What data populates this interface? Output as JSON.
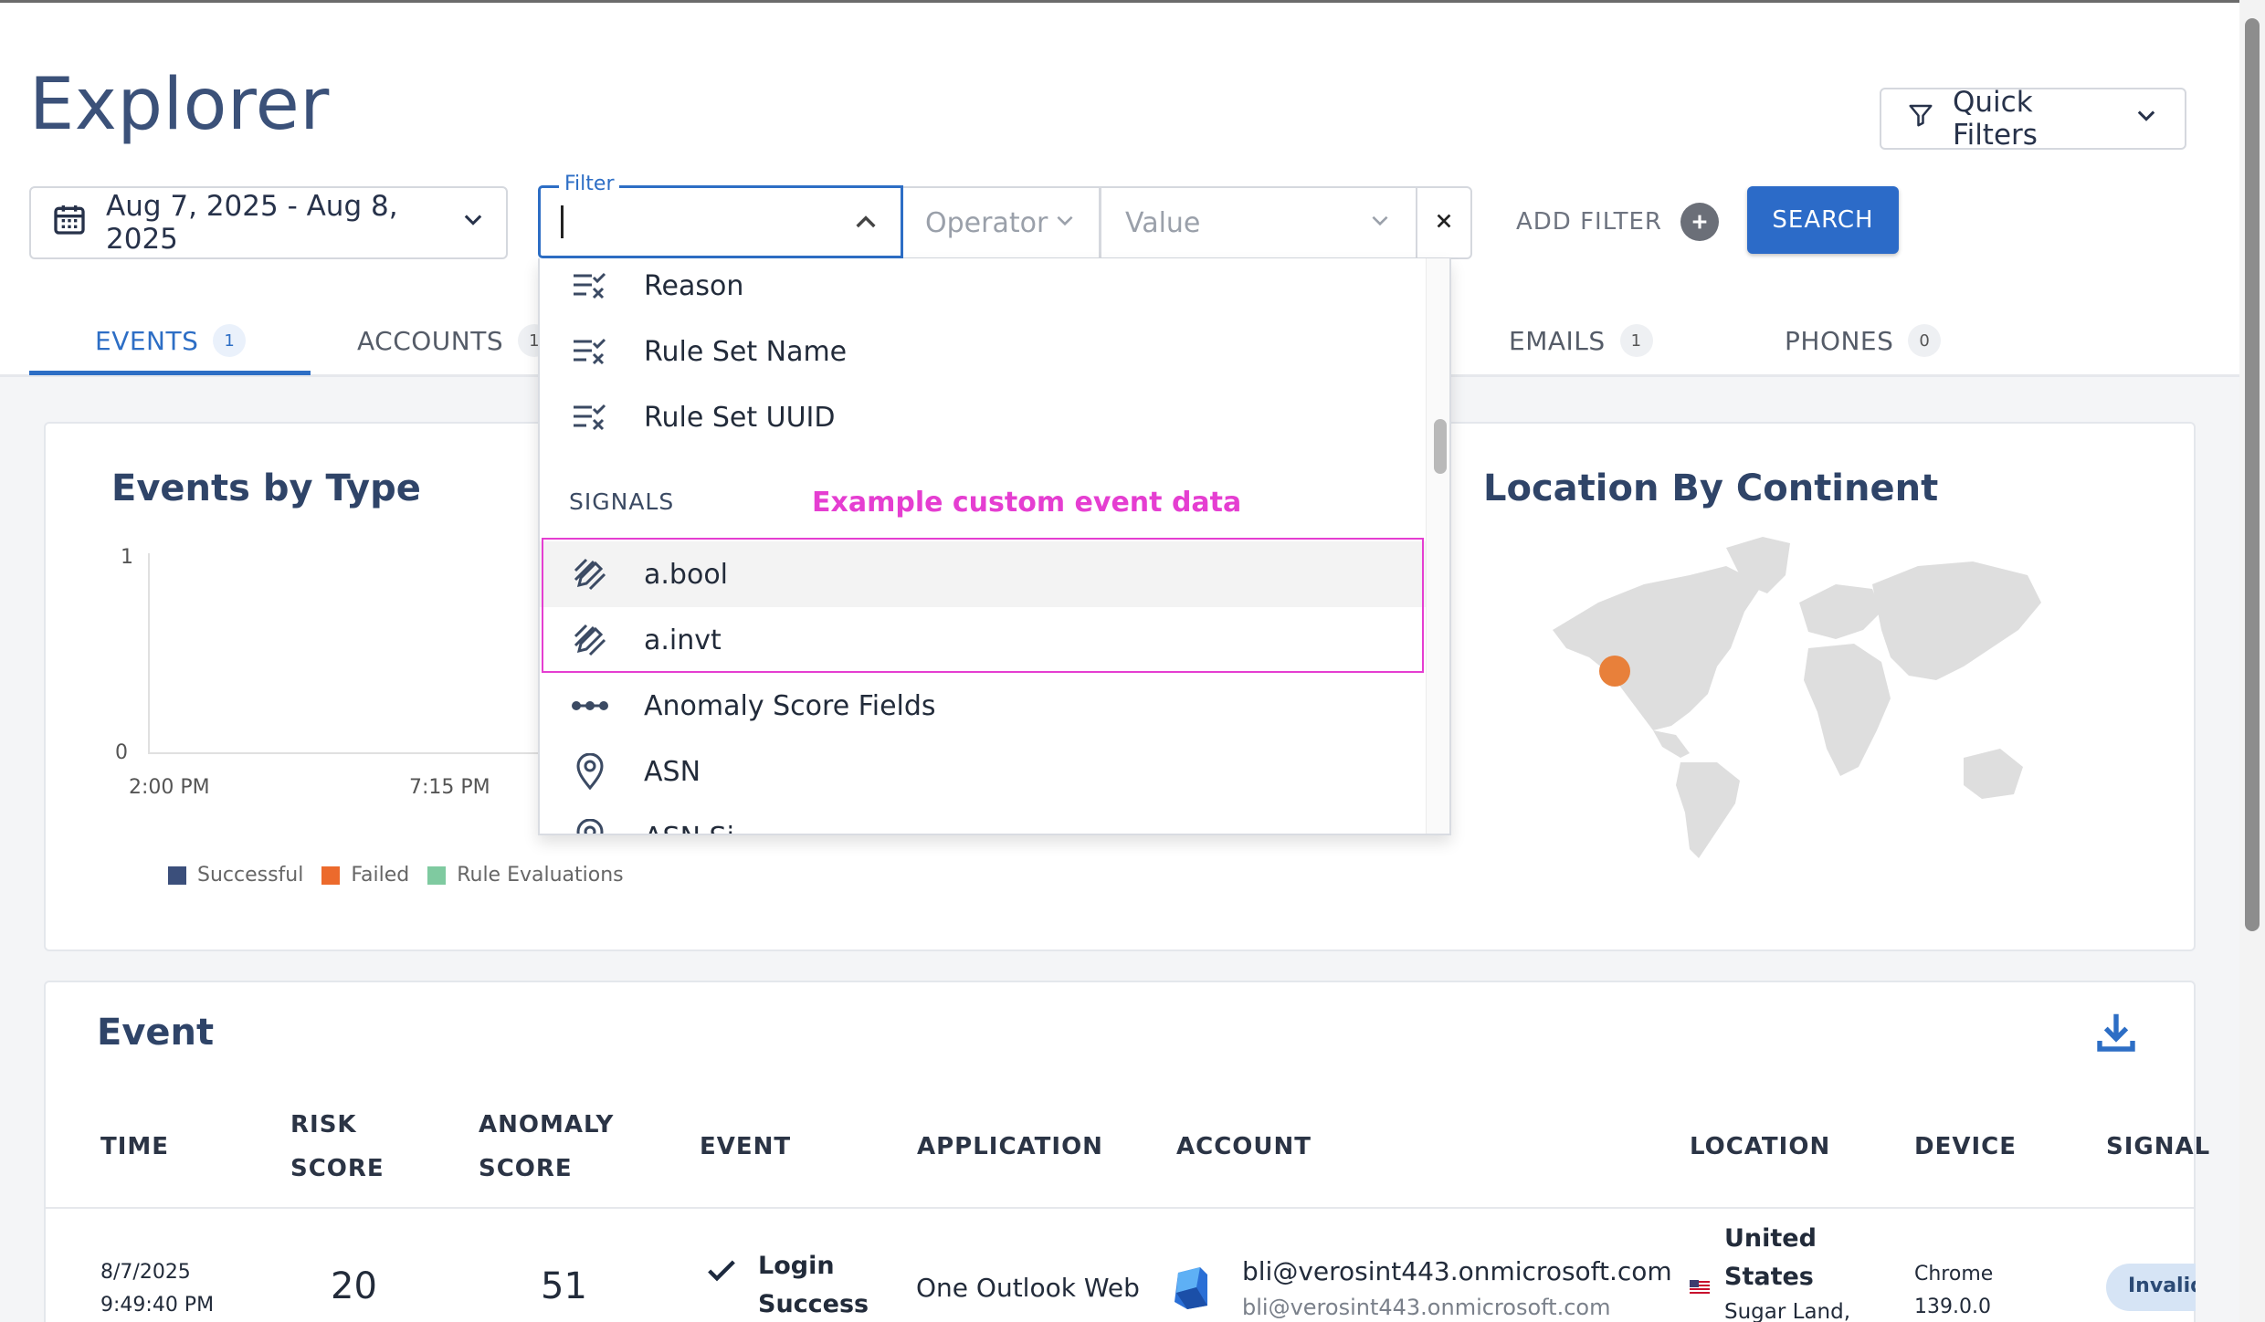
{
  "title": "Explorer",
  "quick_filters": {
    "label": "Quick Filters",
    "icons": [
      "funnel-icon",
      "chevron-down-icon"
    ]
  },
  "date_range": {
    "label": "Aug 7, 2025 - Aug 8, 2025",
    "icon": "calendar-icon"
  },
  "filter": {
    "legend": "Filter",
    "value": "",
    "operator_placeholder": "Operator",
    "value_placeholder": "Value",
    "add_filter": "ADD FILTER",
    "search": "SEARCH"
  },
  "tabs": [
    {
      "label": "EVENTS",
      "count": "1",
      "active": true
    },
    {
      "label": "ACCOUNTS",
      "count": "1"
    },
    {
      "label": "EMAILS",
      "count": "1"
    },
    {
      "label": "PHONES",
      "count": "0"
    }
  ],
  "dropdown": {
    "items_top": [
      "Reason",
      "Rule Set Name",
      "Rule Set UUID"
    ],
    "section": "SIGNALS",
    "annotation": "Example custom event data",
    "items_signals": [
      "a.bool",
      "a.invt",
      "Anomaly Score Fields",
      "ASN",
      "ASN Si..."
    ]
  },
  "events_chart": {
    "title": "Events by Type",
    "chart_data": {
      "type": "bar",
      "title": "Events by Type",
      "x_ticks": [
        "2:00 PM",
        "7:15 PM"
      ],
      "y_ticks": [
        "1",
        "0"
      ],
      "ylim": [
        0,
        1
      ],
      "series": [
        {
          "name": "Successful",
          "color": "#3b4f7b",
          "values": []
        },
        {
          "name": "Failed",
          "color": "#ec6a2c",
          "values": []
        },
        {
          "name": "Rule Evaluations",
          "color": "#7fcaa0",
          "values": []
        }
      ]
    }
  },
  "location": {
    "title": "Location By Continent",
    "marker_color": "#e8803a"
  },
  "event_table": {
    "title": "Event",
    "headers": {
      "time": "TIME",
      "risk_1": "RISK",
      "risk_2": "SCORE",
      "anomaly_1": "ANOMALY",
      "anomaly_2": "SCORE",
      "event": "EVENT",
      "application": "APPLICATION",
      "account": "ACCOUNT",
      "location": "LOCATION",
      "device": "DEVICE",
      "signals": "SIGNAL"
    },
    "row": {
      "date": "8/7/2025",
      "time": "9:49:40 PM",
      "risk": "20",
      "anomaly": "51",
      "event_1": "Login",
      "event_2": "Success",
      "application": "One Outlook Web",
      "account_primary": "bli@verosint443.onmicrosoft.com",
      "account_secondary": "bli@verosint443.onmicrosoft.com",
      "location_1": "United",
      "location_2": "States",
      "location_3": "Sugar Land,",
      "device_1": "Chrome",
      "device_2": "139.0.0",
      "signal_badge": "Invalid"
    }
  }
}
